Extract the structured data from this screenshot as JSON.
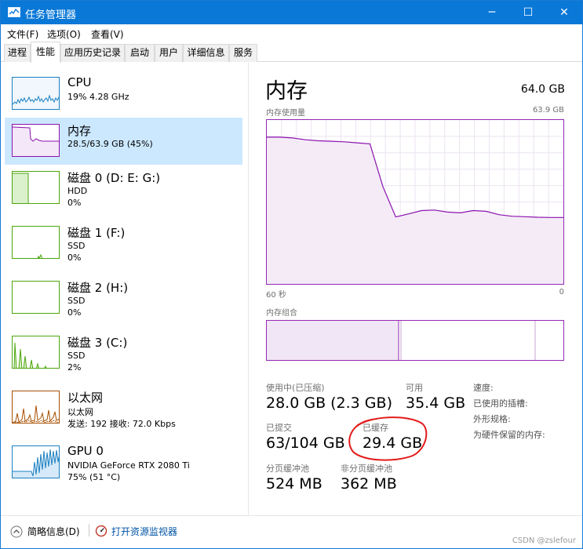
{
  "window": {
    "title": "任务管理器",
    "minimize_glyph": "─",
    "maximize_glyph": "☐",
    "close_glyph": "✕"
  },
  "menu": [
    "文件(F)",
    "选项(O)",
    "查看(V)"
  ],
  "tabs": [
    "进程",
    "性能",
    "应用历史记录",
    "启动",
    "用户",
    "详细信息",
    "服务"
  ],
  "active_tab": "性能",
  "resources": [
    {
      "name": "CPU",
      "line1": "19% 4.28 GHz",
      "line2": "",
      "color": "#1a7fc1"
    },
    {
      "name": "内存",
      "line1": "28.5/63.9 GB (45%)",
      "line2": "",
      "color": "#8b12ae"
    },
    {
      "name": "磁盘 0 (D: E: G:)",
      "line1": "HDD",
      "line2": "0%",
      "color": "#4da60c"
    },
    {
      "name": "磁盘 1 (F:)",
      "line1": "SSD",
      "line2": "0%",
      "color": "#4da60c"
    },
    {
      "name": "磁盘 2 (H:)",
      "line1": "SSD",
      "line2": "0%",
      "color": "#4da60c"
    },
    {
      "name": "磁盘 3 (C:)",
      "line1": "SSD",
      "line2": "2%",
      "color": "#4da60c"
    },
    {
      "name": "以太网",
      "line1": "以太网",
      "line2": "发送: 192  接收: 72.0 Kbps",
      "color": "#a74f01"
    },
    {
      "name": "GPU 0",
      "line1": "NVIDIA GeForce RTX 2080 Ti",
      "line2": "75% (51 °C)",
      "color": "#1a7fc1"
    }
  ],
  "memory": {
    "title": "内存",
    "total": "64.0 GB",
    "usage_label": "内存使用量",
    "usage_max": "63.9 GB",
    "time_left": "60 秒",
    "time_right": "0",
    "composition_label": "内存组合",
    "graph_color": "#8b12ae",
    "usage_history_gb": [
      57.2,
      57.2,
      56.9,
      56.2,
      55.8,
      55.6,
      55.4,
      55.0,
      54.6,
      38.0,
      26.1,
      27.3,
      28.6,
      28.8,
      28.0,
      27.7,
      28.6,
      28.3,
      27.0,
      26.4,
      26.2,
      26.0,
      25.9,
      25.9
    ],
    "stats": {
      "in_use_label": "使用中(已压缩)",
      "in_use_value": "28.0 GB (2.3 GB)",
      "available_label": "可用",
      "available_value": "35.4 GB",
      "committed_label": "已提交",
      "committed_value": "63/104 GB",
      "cached_label": "已缓存",
      "cached_value": "29.4 GB",
      "paged_label": "分页缓冲池",
      "paged_value": "524 MB",
      "nonpaged_label": "非分页缓冲池",
      "nonpaged_value": "362 MB"
    },
    "side_labels": [
      "速度:",
      "已使用的插槽:",
      "外形规格:",
      "为硬件保留的内存:"
    ]
  },
  "footer": {
    "fewer_details": "简略信息(D)",
    "open_monitor": "打开资源监视器",
    "watermark": "CSDN @zslefour"
  }
}
